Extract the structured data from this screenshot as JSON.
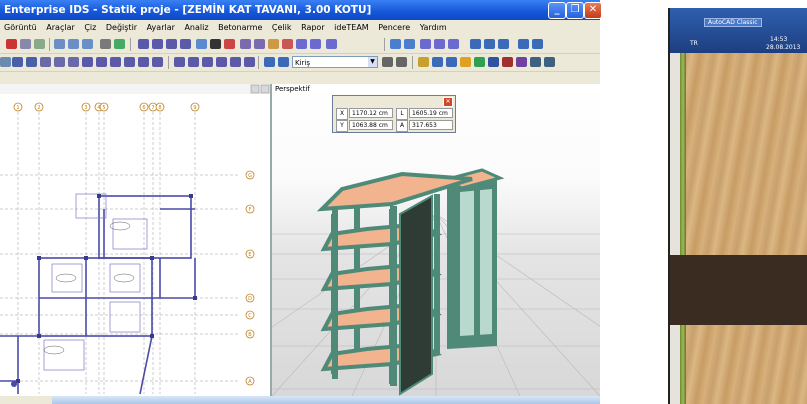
{
  "window": {
    "title": "Enterprise IDS - Statik proje - [ZEMİN KAT TAVANI, 3.00 KOTU]",
    "minimize": "_",
    "maximize": "❐",
    "close": "✕"
  },
  "menu": [
    "Görüntü",
    "Araçlar",
    "Çiz",
    "Değiştir",
    "Ayarlar",
    "Analiz",
    "Betonarme",
    "Çelik",
    "Rapor",
    "ideTEAM",
    "Pencere",
    "Yardım"
  ],
  "toolbar": {
    "layer_combo": "Kiriş",
    "plan_view_label": "",
    "persp_label": "Perspektif"
  },
  "plan": {
    "axes_top": [
      "1",
      "2",
      "3",
      "4",
      "5",
      "6",
      "7",
      "8",
      "9"
    ],
    "axes_right": [
      "G",
      "F",
      "E",
      "D",
      "C",
      "B",
      "A"
    ]
  },
  "coords": {
    "x_key": "X",
    "x_value": "1170.12 cm",
    "l_key": "L",
    "l_value": "1605.19 cm",
    "y_key": "Y",
    "y_value": "1063.88 cm",
    "a_key": "A",
    "a_value": "317.653"
  },
  "device": {
    "app_button": "AutoCAD Classic",
    "lang": "TR",
    "time": "14:53",
    "date": "28.08.2013"
  },
  "colors": {
    "xp_blue": "#1556d8",
    "frame_green": "#4f8a78",
    "slab_peach": "#f2b38f"
  }
}
